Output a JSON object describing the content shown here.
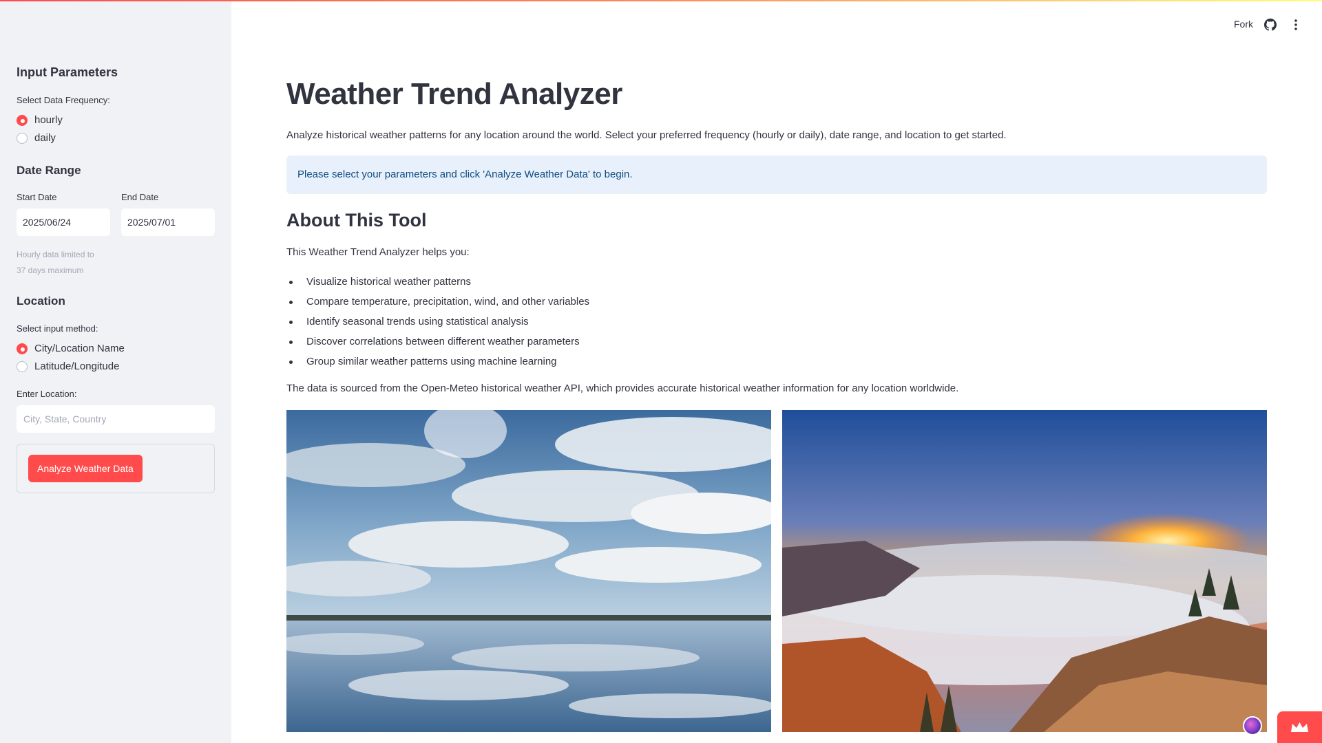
{
  "header": {
    "fork_label": "Fork"
  },
  "sidebar": {
    "input_parameters_heading": "Input Parameters",
    "frequency_label": "Select Data Frequency:",
    "frequency_options": [
      "hourly",
      "daily"
    ],
    "frequency_selected": "hourly",
    "date_range_heading": "Date Range",
    "start_date_label": "Start Date",
    "start_date_value": "2025/06/24",
    "end_date_label": "End Date",
    "end_date_value": "2025/07/01",
    "hint_line1": "Hourly data limited to",
    "hint_line2": "37 days maximum",
    "location_heading": "Location",
    "input_method_label": "Select input method:",
    "input_method_options": [
      "City/Location Name",
      "Latitude/Longitude"
    ],
    "input_method_selected": "City/Location Name",
    "enter_location_label": "Enter Location:",
    "location_placeholder": "City, State, Country",
    "analyze_button_label": "Analyze Weather Data"
  },
  "main": {
    "title": "Weather Trend Analyzer",
    "intro": "Analyze historical weather patterns for any location around the world. Select your preferred frequency (hourly or daily), date range, and location to get started.",
    "info_message": "Please select your parameters and click 'Analyze Weather Data' to begin.",
    "about_heading": "About This Tool",
    "about_lead": "This Weather Trend Analyzer helps you:",
    "about_bullets": [
      "Visualize historical weather patterns",
      "Compare temperature, precipitation, wind, and other variables",
      "Identify seasonal trends using statistical analysis",
      "Discover correlations between different weather parameters",
      "Group similar weather patterns using machine learning"
    ],
    "data_source": "The data is sourced from the Open-Meteo historical weather API, which provides accurate historical weather information for any location worldwide."
  },
  "colors": {
    "accent": "#ff4b4b",
    "sidebar_bg": "#f0f2f6",
    "info_bg": "#e8f1fb",
    "info_text": "#0f4b82"
  }
}
